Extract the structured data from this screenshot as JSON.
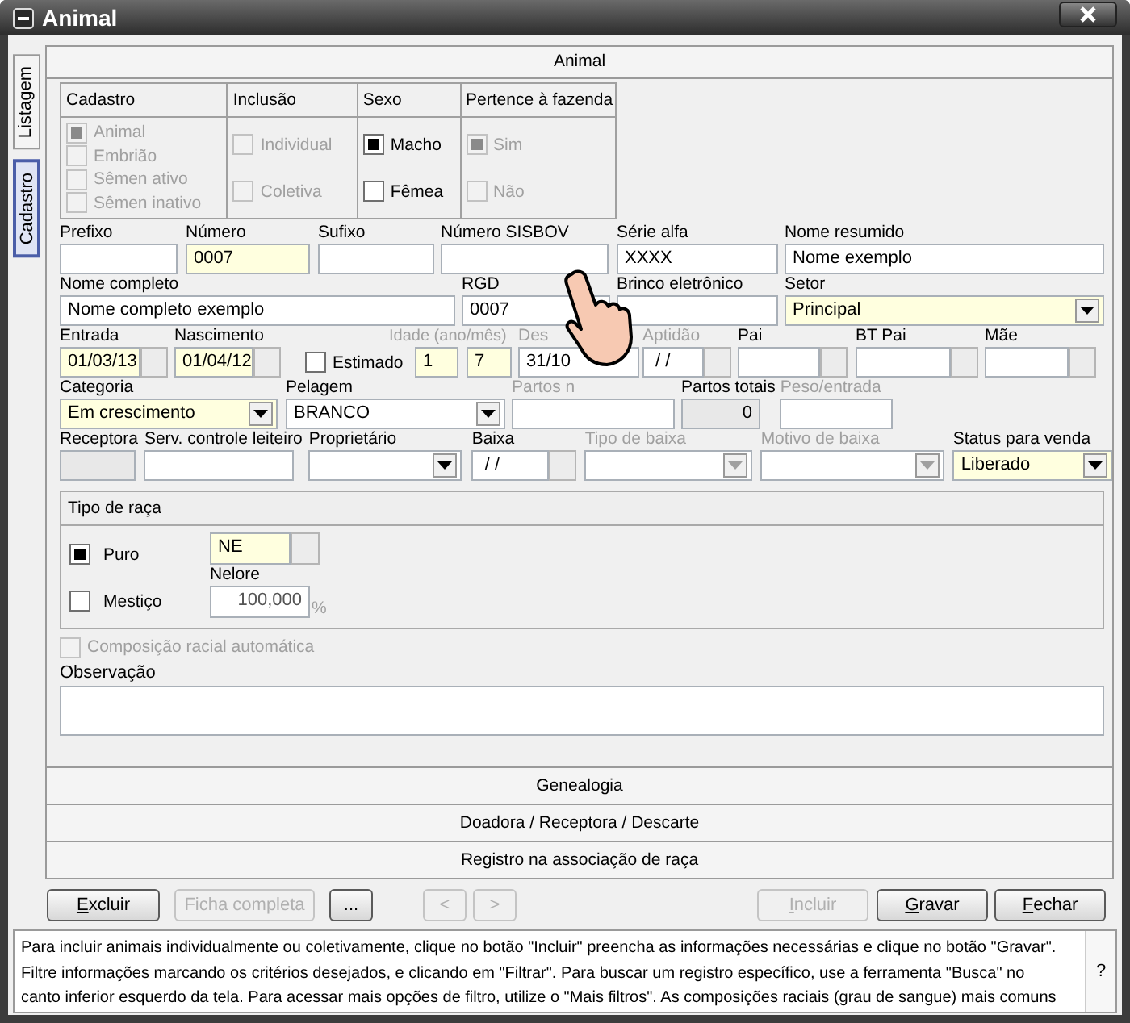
{
  "window": {
    "title": "Animal"
  },
  "side_tabs": [
    {
      "label": "Listagem",
      "selected": false
    },
    {
      "label": "Cadastro",
      "selected": true
    }
  ],
  "panel": {
    "title": "Animal"
  },
  "check_groups": [
    {
      "title": "Cadastro",
      "items": [
        {
          "label": "Animal",
          "checked": true,
          "disabled": true
        },
        {
          "label": "Embrião",
          "checked": false,
          "disabled": true
        },
        {
          "label": "Sêmen ativo",
          "checked": false,
          "disabled": true
        },
        {
          "label": "Sêmen inativo",
          "checked": false,
          "disabled": true
        }
      ]
    },
    {
      "title": "Inclusão",
      "items": [
        {
          "label": "Individual",
          "checked": false,
          "disabled": true
        },
        {
          "label": "Coletiva",
          "checked": false,
          "disabled": true
        }
      ]
    },
    {
      "title": "Sexo",
      "items": [
        {
          "label": "Macho",
          "checked": true,
          "disabled": false
        },
        {
          "label": "Fêmea",
          "checked": false,
          "disabled": false
        }
      ]
    },
    {
      "title": "Pertence à fazenda",
      "items": [
        {
          "label": "Sim",
          "checked": true,
          "disabled": true
        },
        {
          "label": "Não",
          "checked": false,
          "disabled": true
        }
      ]
    }
  ],
  "form_rows": [
    [
      {
        "label": "Prefixo",
        "kind": "text",
        "required": false,
        "disabled": false,
        "readonly": false
      },
      {
        "label": "Número",
        "kind": "text",
        "value": "0007",
        "required": true,
        "disabled": false,
        "readonly": false
      },
      {
        "label": "Sufixo",
        "kind": "text",
        "required": false,
        "disabled": false,
        "readonly": false
      },
      {
        "label": "Número SISBOV",
        "kind": "text",
        "required": false,
        "disabled": false,
        "readonly": false
      },
      {
        "label": "Série alfa",
        "kind": "text",
        "value": "XXXX",
        "required": false,
        "disabled": false,
        "readonly": false
      },
      {
        "label": "Nome resumido",
        "kind": "text",
        "value": "Nome exemplo",
        "required": false,
        "disabled": false,
        "readonly": false
      }
    ],
    [
      {
        "label": "Nome completo",
        "kind": "text",
        "value": "Nome completo exemplo",
        "required": false,
        "disabled": false,
        "readonly": false
      },
      {
        "label": "RGD",
        "kind": "text",
        "value": "0007",
        "required": false,
        "disabled": false,
        "readonly": false
      },
      {
        "label": "Brinco eletrônico",
        "kind": "text",
        "required": false,
        "disabled": false,
        "readonly": false
      },
      {
        "label": "Setor",
        "kind": "combo",
        "value": "Principal",
        "required": true,
        "disabled": false,
        "readonly": false
      }
    ],
    [
      {
        "label": "Entrada",
        "kind": "date",
        "value": "01/03/13",
        "required": true,
        "disabled": false,
        "readonly": false
      },
      {
        "label": "Nascimento",
        "kind": "date",
        "value": "01/04/12",
        "required": true,
        "disabled": false,
        "readonly": false
      },
      {
        "label": "Estimado",
        "kind": "check",
        "checked": false
      },
      {
        "label": "Idade (ano/mês)",
        "kind": "pair",
        "values": [
          "1",
          "7"
        ],
        "required": true,
        "disabled": true,
        "readonly": false
      },
      {
        "label": "Des",
        "kind": "text",
        "value": "31/10",
        "required": false,
        "disabled": true,
        "readonly": false
      },
      {
        "label": "Aptidão",
        "kind": "date",
        "value": " / /",
        "required": false,
        "disabled": true,
        "readonly": false
      },
      {
        "label": "Pai",
        "kind": "date",
        "required": false,
        "disabled": false,
        "readonly": false
      },
      {
        "label": "BT Pai",
        "kind": "date",
        "required": false,
        "disabled": false,
        "readonly": false
      },
      {
        "label": "Mãe",
        "kind": "date",
        "required": false,
        "disabled": false,
        "readonly": false
      }
    ],
    [
      {
        "label": "Categoria",
        "kind": "combo",
        "value": "Em crescimento",
        "required": true,
        "disabled": false,
        "readonly": false
      },
      {
        "label": "Pelagem",
        "kind": "combo",
        "value": "BRANCO",
        "required": false,
        "disabled": false,
        "readonly": false
      },
      {
        "label": "Partos n",
        "kind": "text",
        "required": false,
        "disabled": true,
        "readonly": false
      },
      {
        "label": "Partos totais",
        "kind": "number",
        "value": "0",
        "required": false,
        "disabled": false,
        "readonly": true
      },
      {
        "label": "Peso/entrada",
        "kind": "text",
        "required": false,
        "disabled": true,
        "readonly": false
      }
    ],
    [
      {
        "label": "Receptora",
        "kind": "text",
        "required": false,
        "disabled": false,
        "readonly": true
      },
      {
        "label": "Serv. controle leiteiro",
        "kind": "text",
        "required": false,
        "disabled": false,
        "readonly": false
      },
      {
        "label": "Proprietário",
        "kind": "combo",
        "required": false,
        "disabled": false,
        "readonly": false
      },
      {
        "label": "Baixa",
        "kind": "date",
        "value": " / /",
        "required": false,
        "disabled": false,
        "readonly": false
      },
      {
        "label": "Tipo de baixa",
        "kind": "combo",
        "required": false,
        "disabled": true,
        "readonly": false
      },
      {
        "label": "Motivo de baixa",
        "kind": "combo",
        "required": false,
        "disabled": true,
        "readonly": false
      },
      {
        "label": "Status para venda",
        "kind": "combo",
        "value": "Liberado",
        "required": true,
        "disabled": false,
        "readonly": false
      }
    ]
  ],
  "breed_type": {
    "title": "Tipo de raça",
    "options": [
      {
        "label": "Puro",
        "checked": true
      },
      {
        "label": "Mestiço",
        "checked": false
      }
    ],
    "breed_code": "NE",
    "breed_name": "Nelore",
    "percent": "100,000",
    "percent_unit": "%"
  },
  "auto_composition": {
    "label": "Composição racial automática",
    "checked": false,
    "disabled": true
  },
  "notes": {
    "label": "Observação"
  },
  "sections": [
    "Genealogia",
    "Doadora / Receptora / Descarte",
    "Registro na associação de raça"
  ],
  "buttons": [
    {
      "label": "Excluir",
      "disabled": false,
      "accel": true
    },
    {
      "label": "Ficha completa",
      "disabled": true,
      "accel": false
    },
    {
      "label": "...",
      "disabled": false,
      "accel": false
    },
    {
      "label": "<",
      "disabled": true,
      "accel": false
    },
    {
      "label": ">",
      "disabled": true,
      "accel": false
    },
    {
      "label": "Incluir",
      "disabled": true,
      "accel": true
    },
    {
      "label": "Gravar",
      "disabled": false,
      "accel": true
    },
    {
      "label": "Fechar",
      "disabled": false,
      "accel": true
    }
  ],
  "help": {
    "lines": [
      "Para incluir animais individualmente ou coletivamente, clique no botão \"Incluir\" preencha as informações necessárias e clique no botão \"Gravar\".",
      "Filtre informações marcando os critérios desejados, e clicando em \"Filtrar\". Para buscar um registro específico, use a ferramenta \"Busca\" no",
      "canto inferior esquerdo da tela. Para acessar mais opções de filtro, utilize o \"Mais filtros\". As composições raciais (grau de sangue) mais comuns"
    ],
    "button": "?"
  }
}
